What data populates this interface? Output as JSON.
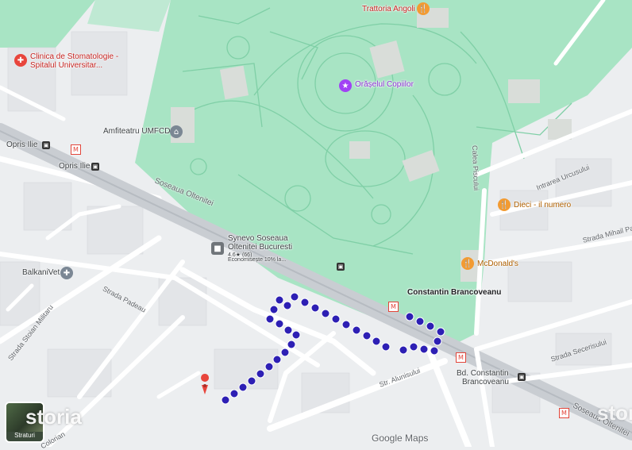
{
  "map": {
    "attribution": "Google Maps",
    "brand": "storia",
    "layers_button": "Straturi",
    "colors": {
      "park": "#a8e4c4",
      "park_path": "#7fcfa6",
      "road_major": "#c9cdd2",
      "road": "#ffffff",
      "block": "#e3e5e8",
      "route_dots": "#2d1fb4",
      "place_pin": "#e8453c"
    },
    "pois": {
      "clinic": "Clinica de Stomatologie - Spitalul Universitar...",
      "trattoria": "Trattoria Angoli",
      "orasel": "Orășelul Copiilor",
      "amfiteatru": "Amfiteatru UMFCD",
      "dieci": "Dieci - il numero",
      "mcdonalds": "McDonald's",
      "synevo_1": "Synevo Soseaua",
      "synevo_2": "Oltenitei Bucuresti",
      "synevo_rating": "4.6★ (66)",
      "synevo_note": "Economisește 10% la...",
      "balkanivet": "BalkaniVet",
      "constantin": "Constantin Brancoveanu",
      "bd_constantin_1": "Bd. Constantin",
      "bd_constantin_2": "Brancoveanu",
      "opris_1": "Opris Ilie",
      "opris_2": "Opris Ilie"
    },
    "streets": {
      "soseaua_oltenitei": "Soseaua Oltenitei",
      "soseaua_oltenitei_2": "Soseaua Oltenitei",
      "strada_padeau": "Strada Padeau",
      "strada_stoian": "Strada Stoian Militaru",
      "str_alunisului": "Str. Alunisului",
      "calea_piscului": "Calea Piscului",
      "intrarea_urcusului": "Intrarea Urcusului",
      "strada_mihail": "Strada Mihail Pa",
      "strada_secerisului": "Strada Secerisului",
      "strada_colorian": "Colorian"
    }
  }
}
